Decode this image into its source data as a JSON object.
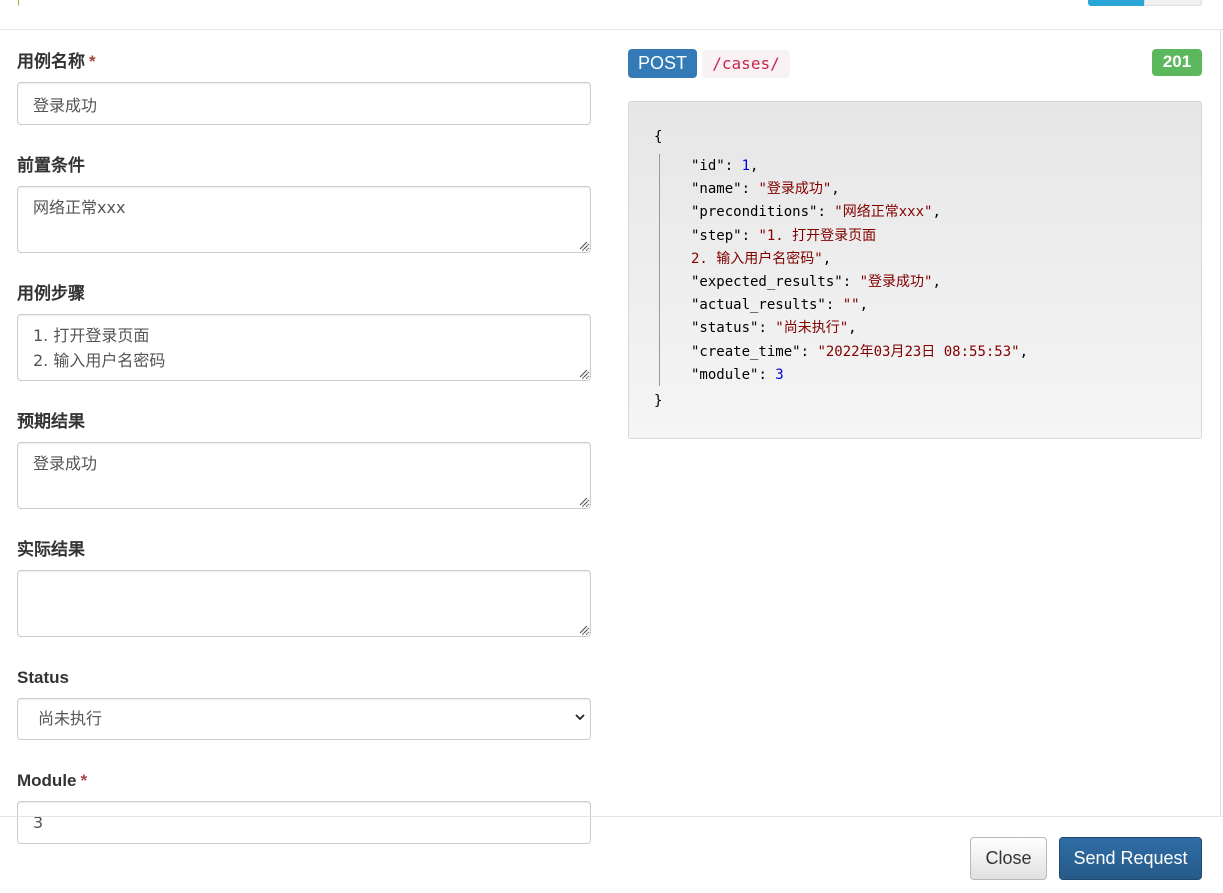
{
  "form": {
    "fields": [
      {
        "label": "用例名称",
        "required": true,
        "value": "登录成功"
      },
      {
        "label": "前置条件",
        "required": false,
        "value": "网络正常xxx"
      },
      {
        "label": "用例步骤",
        "required": false,
        "value": "1. 打开登录页面\n2. 输入用户名密码"
      },
      {
        "label": "预期结果",
        "required": false,
        "value": "登录成功"
      },
      {
        "label": "实际结果",
        "required": false,
        "value": ""
      },
      {
        "label": "Status",
        "required": false,
        "value": "尚未执行"
      },
      {
        "label": "Module",
        "required": true,
        "value": "3"
      }
    ],
    "required_mark": "*"
  },
  "request": {
    "method": "POST",
    "path": "/cases/"
  },
  "response": {
    "status_code": "201",
    "open_brace": "{",
    "close_brace": "}",
    "lines": [
      {
        "key": "\"id\"",
        "sep": ": ",
        "value": "1",
        "kind": "n",
        "end": ","
      },
      {
        "key": "\"name\"",
        "sep": ": ",
        "value": "\"登录成功\"",
        "kind": "s",
        "end": ","
      },
      {
        "key": "\"preconditions\"",
        "sep": ": ",
        "value": "\"网络正常xxx\"",
        "kind": "s",
        "end": ","
      },
      {
        "key": "\"step\"",
        "sep": ": ",
        "value": "\"1. 打开登录页面\n2. 输入用户名密码\"",
        "kind": "s",
        "end": ","
      },
      {
        "key": "\"expected_results\"",
        "sep": ": ",
        "value": "\"登录成功\"",
        "kind": "s",
        "end": ","
      },
      {
        "key": "\"actual_results\"",
        "sep": ": ",
        "value": "\"\"",
        "kind": "s",
        "end": ","
      },
      {
        "key": "\"status\"",
        "sep": ": ",
        "value": "\"尚未执行\"",
        "kind": "s",
        "end": ","
      },
      {
        "key": "\"create_time\"",
        "sep": ": ",
        "value": "\"2022年03月23日 08:55:53\"",
        "kind": "s",
        "end": ","
      },
      {
        "key": "\"module\"",
        "sep": ": ",
        "value": "3",
        "kind": "n",
        "end": ""
      }
    ]
  },
  "footer": {
    "close_label": "Close",
    "send_label": "Send Request"
  },
  "colors": {
    "method": "#337ab7",
    "status": "#5cb85c",
    "send": "#265a88",
    "required": "#a94442"
  }
}
